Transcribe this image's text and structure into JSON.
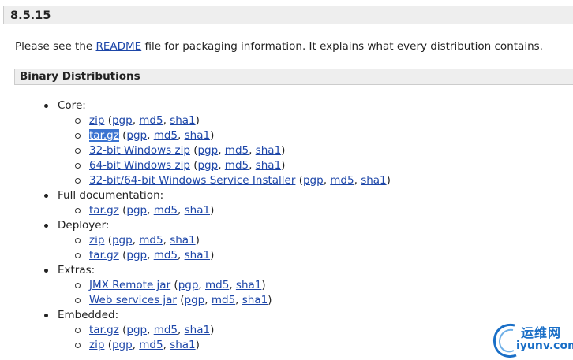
{
  "version": "8.5.15",
  "intro": {
    "prefix": "Please see the ",
    "link": "README",
    "suffix": " file for packaging information. It explains what every distribution contains."
  },
  "section_title": "Binary Distributions",
  "sig_labels": {
    "pgp": "pgp",
    "md5": "md5",
    "sha1": "sha1"
  },
  "groups": [
    {
      "label": "Core:",
      "items": [
        {
          "name": "zip"
        },
        {
          "name": "tar.gz",
          "selected": true
        },
        {
          "name": "32-bit Windows zip"
        },
        {
          "name": "64-bit Windows zip"
        },
        {
          "name": "32-bit/64-bit Windows Service Installer"
        }
      ]
    },
    {
      "label": "Full documentation:",
      "items": [
        {
          "name": "tar.gz"
        }
      ]
    },
    {
      "label": "Deployer:",
      "items": [
        {
          "name": "zip"
        },
        {
          "name": "tar.gz"
        }
      ]
    },
    {
      "label": "Extras:",
      "items": [
        {
          "name": "JMX Remote jar"
        },
        {
          "name": "Web services jar"
        }
      ]
    },
    {
      "label": "Embedded:",
      "items": [
        {
          "name": "tar.gz"
        },
        {
          "name": "zip"
        }
      ]
    }
  ],
  "watermark": {
    "cn": "运维网",
    "url": "iyunv.com"
  },
  "colors": {
    "link": "#1d46a8",
    "selection": "#3b74d1",
    "header_bg": "#eeeeee",
    "watermark": "#1a6fc7"
  }
}
